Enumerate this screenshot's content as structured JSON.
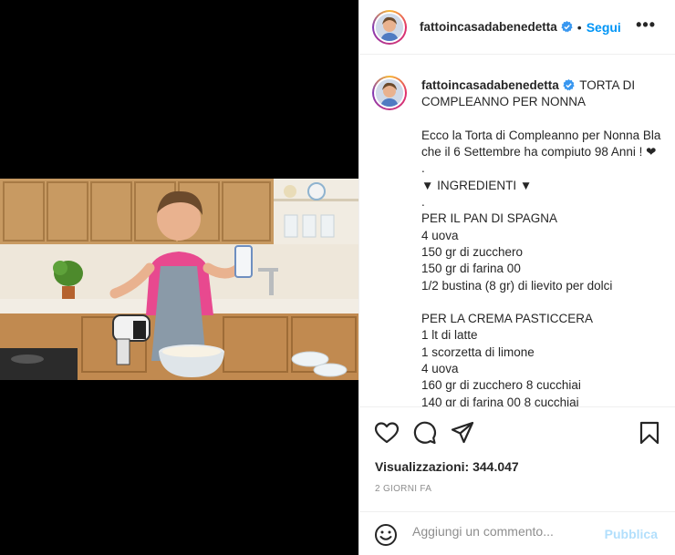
{
  "post": {
    "username": "fattoincasadabenedetta",
    "separator": "•",
    "follow_label": "Segui",
    "more_label": "•••",
    "caption_title": " TORTA DI\nCOMPLEANNO PER NONNA",
    "caption_body": "Ecco la Torta di Compleanno per Nonna Bla\nche il 6 Settembre ha compiuto 98 Anni ! ❤\n.\n▼ INGREDIENTI ▼\n.\nPER IL PAN DI SPAGNA\n4 uova\n150 gr di zucchero\n150 gr di farina 00\n1/2 bustina (8 gr) di lievito per dolci\n\nPER LA CREMA PASTICCERA\n1 lt di latte\n1 scorzetta di limone\n4 uova\n160 gr di zucchero 8 cucchiai\n140 gr di farina 00 8 cucchiai",
    "views_label": "Visualizzazioni: 344.047",
    "time_label": "2 GIORNI FA",
    "comment_placeholder": "Aggiungi un commento...",
    "publish_label": "Pubblica"
  },
  "icons": {
    "like": "heart-icon",
    "comment": "comment-icon",
    "share": "share-icon",
    "save": "bookmark-icon",
    "emoji": "emoji-icon",
    "verified": "verified-badge-icon"
  },
  "colors": {
    "follow": "#0095f6",
    "publish_disabled": "#b2dffc",
    "verified": "#3897f0",
    "secondary_text": "#8e8e8e"
  }
}
